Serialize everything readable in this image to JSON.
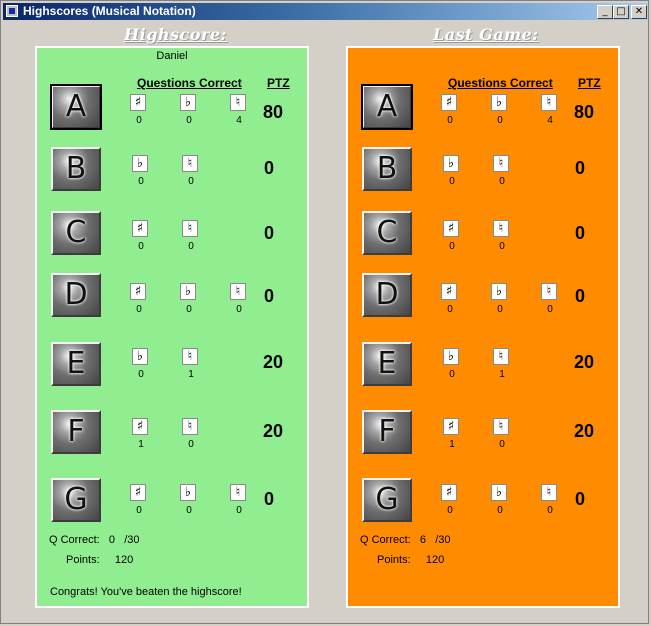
{
  "window": {
    "title": "Highscores (Musical Notation)",
    "controls": {
      "minimize": "_",
      "maximize": "□",
      "close": "✕"
    }
  },
  "highscore": {
    "heading": "Highscore:",
    "player": "Daniel",
    "col_questions": "Questions Correct",
    "col_ptz": "PTZ",
    "rows": [
      {
        "note": "A",
        "icons": [
          "sharp-icon",
          "flat-icon",
          "natural-icon"
        ],
        "glyphs": [
          "♯",
          "♭",
          "♮"
        ],
        "counts": [
          "0",
          "0",
          "4"
        ],
        "ptz": "80"
      },
      {
        "note": "B",
        "icons": [
          "flat-icon",
          "natural-icon"
        ],
        "glyphs": [
          "♭",
          "♮"
        ],
        "counts": [
          "0",
          "0"
        ],
        "ptz": "0"
      },
      {
        "note": "C",
        "icons": [
          "sharp-icon",
          "natural-icon"
        ],
        "glyphs": [
          "♯",
          "♮"
        ],
        "counts": [
          "0",
          "0"
        ],
        "ptz": "0"
      },
      {
        "note": "D",
        "icons": [
          "sharp-icon",
          "flat-icon",
          "natural-icon"
        ],
        "glyphs": [
          "♯",
          "♭",
          "♮"
        ],
        "counts": [
          "0",
          "0",
          "0"
        ],
        "ptz": "0"
      },
      {
        "note": "E",
        "icons": [
          "flat-icon",
          "natural-icon"
        ],
        "glyphs": [
          "♭",
          "♮"
        ],
        "counts": [
          "0",
          "1"
        ],
        "ptz": "20"
      },
      {
        "note": "F",
        "icons": [
          "sharp-icon",
          "natural-icon"
        ],
        "glyphs": [
          "♯",
          "♮"
        ],
        "counts": [
          "1",
          "0"
        ],
        "ptz": "20"
      },
      {
        "note": "G",
        "icons": [
          "sharp-icon",
          "flat-icon",
          "natural-icon"
        ],
        "glyphs": [
          "♯",
          "♭",
          "♮"
        ],
        "counts": [
          "0",
          "0",
          "0"
        ],
        "ptz": "0"
      }
    ],
    "q_correct_label": "Q Correct:",
    "q_correct_value": "0",
    "q_total": "/30",
    "points_label": "Points:",
    "points_value": "120",
    "message": "Congrats! You've beaten the highscore!"
  },
  "last_game": {
    "heading": "Last Game:",
    "col_questions": "Questions Correct",
    "col_ptz": "PTZ",
    "rows": [
      {
        "note": "A",
        "icons": [
          "sharp-icon",
          "flat-icon",
          "natural-icon"
        ],
        "glyphs": [
          "♯",
          "♭",
          "♮"
        ],
        "counts": [
          "0",
          "0",
          "4"
        ],
        "ptz": "80"
      },
      {
        "note": "B",
        "icons": [
          "flat-icon",
          "natural-icon"
        ],
        "glyphs": [
          "♭",
          "♮"
        ],
        "counts": [
          "0",
          "0"
        ],
        "ptz": "0"
      },
      {
        "note": "C",
        "icons": [
          "sharp-icon",
          "natural-icon"
        ],
        "glyphs": [
          "♯",
          "♮"
        ],
        "counts": [
          "0",
          "0"
        ],
        "ptz": "0"
      },
      {
        "note": "D",
        "icons": [
          "sharp-icon",
          "flat-icon",
          "natural-icon"
        ],
        "glyphs": [
          "♯",
          "♭",
          "♮"
        ],
        "counts": [
          "0",
          "0",
          "0"
        ],
        "ptz": "0"
      },
      {
        "note": "E",
        "icons": [
          "flat-icon",
          "natural-icon"
        ],
        "glyphs": [
          "♭",
          "♮"
        ],
        "counts": [
          "0",
          "1"
        ],
        "ptz": "20"
      },
      {
        "note": "F",
        "icons": [
          "sharp-icon",
          "natural-icon"
        ],
        "glyphs": [
          "♯",
          "♮"
        ],
        "counts": [
          "1",
          "0"
        ],
        "ptz": "20"
      },
      {
        "note": "G",
        "icons": [
          "sharp-icon",
          "flat-icon",
          "natural-icon"
        ],
        "glyphs": [
          "♯",
          "♭",
          "♮"
        ],
        "counts": [
          "0",
          "0",
          "0"
        ],
        "ptz": "0"
      }
    ],
    "q_correct_label": "Q Correct:",
    "q_correct_value": "6",
    "q_total": "/30",
    "points_label": "Points:",
    "points_value": "120"
  },
  "colors": {
    "highscore_panel": "#90ee90",
    "last_game_panel": "#ff8c00",
    "titlebar": "#0a246a"
  }
}
